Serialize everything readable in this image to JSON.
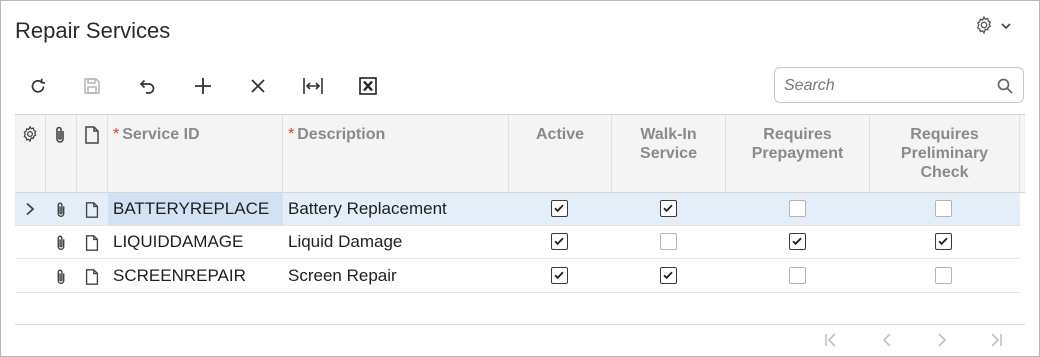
{
  "page": {
    "title": "Repair Services"
  },
  "header_actions": {
    "settings_icon": "gear-icon",
    "dropdown_icon": "chevron-down-icon"
  },
  "toolbar": {
    "buttons": [
      {
        "name": "refresh",
        "icon": "refresh-icon"
      },
      {
        "name": "save",
        "icon": "save-icon",
        "disabled": true
      },
      {
        "name": "undo",
        "icon": "undo-icon"
      },
      {
        "name": "add",
        "icon": "plus-icon"
      },
      {
        "name": "delete",
        "icon": "close-icon"
      },
      {
        "name": "fit-columns",
        "icon": "fit-width-icon"
      },
      {
        "name": "export-excel",
        "icon": "excel-icon"
      }
    ]
  },
  "search": {
    "placeholder": "Search",
    "value": ""
  },
  "grid": {
    "columns": {
      "service_id": "Service ID",
      "description": "Description",
      "active": "Active",
      "walk_in_service_1": "Walk-In",
      "walk_in_service_2": "Service",
      "requires_prepayment_1": "Requires",
      "requires_prepayment_2": "Prepayment",
      "requires_preliminary_check_1": "Requires",
      "requires_preliminary_check_2": "Preliminary",
      "requires_preliminary_check_3": "Check",
      "required_marker": "*"
    },
    "rows": [
      {
        "service_id": "BATTERYREPLACE",
        "description": "Battery Replacement",
        "active": true,
        "walk_in_service": true,
        "requires_prepayment": false,
        "requires_preliminary_check": false,
        "selected": true
      },
      {
        "service_id": "LIQUIDDAMAGE",
        "description": "Liquid Damage",
        "active": true,
        "walk_in_service": false,
        "requires_prepayment": true,
        "requires_preliminary_check": true,
        "selected": false
      },
      {
        "service_id": "SCREENREPAIR",
        "description": "Screen Repair",
        "active": true,
        "walk_in_service": true,
        "requires_prepayment": false,
        "requires_preliminary_check": false,
        "selected": false
      }
    ]
  },
  "pager": {
    "icons": [
      "first-page-icon",
      "previous-page-icon",
      "next-page-icon",
      "last-page-icon"
    ]
  }
}
